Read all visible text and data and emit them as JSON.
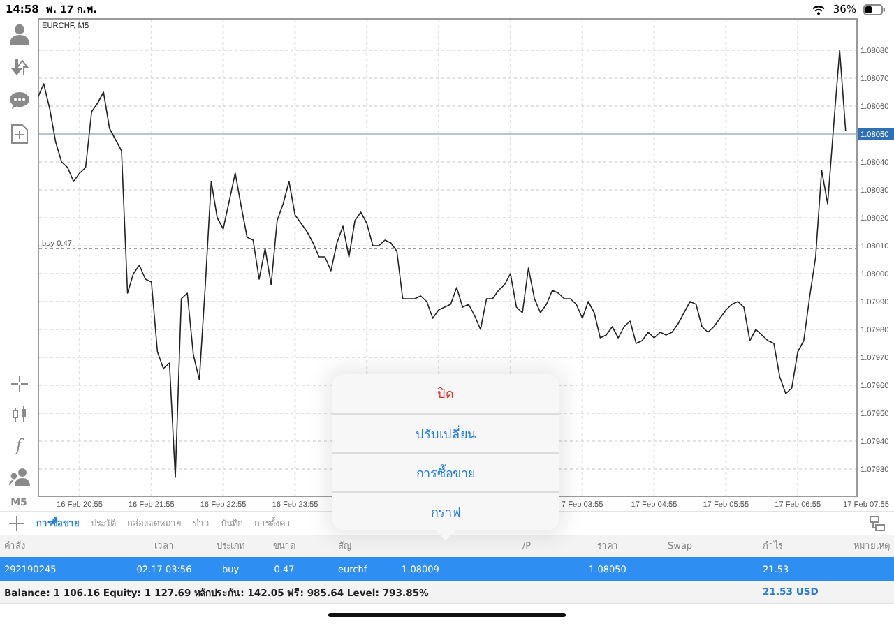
{
  "status_bar": {
    "time": "14:58",
    "date": "พ. 17 ก.พ.",
    "battery": "36%"
  },
  "toolbar": {
    "indicators_glyph": "f",
    "timeframe": "M5"
  },
  "chart": {
    "title": "EURCHF, M5",
    "chart_data": {
      "type": "line",
      "grid": true,
      "ylim": [
        1.0792,
        1.08091
      ],
      "categories": [
        null,
        null,
        null,
        null,
        null,
        null,
        null,
        "16 Feb 20:55",
        null,
        null,
        null,
        null,
        null,
        null,
        null,
        null,
        null,
        null,
        null,
        "16 Feb 21:55",
        null,
        null,
        null,
        null,
        null,
        null,
        null,
        null,
        null,
        null,
        null,
        "16 Feb 22:55",
        null,
        null,
        null,
        null,
        null,
        null,
        null,
        null,
        null,
        null,
        null,
        "16 Feb 23:55",
        null,
        null,
        null,
        null,
        null,
        null,
        null,
        null,
        null,
        null,
        null,
        null,
        null,
        null,
        null,
        null,
        null,
        null,
        null,
        null,
        null,
        null,
        null,
        null,
        null,
        null,
        null,
        null,
        null,
        null,
        null,
        null,
        null,
        null,
        null,
        null,
        null,
        null,
        null,
        null,
        null,
        null,
        null,
        null,
        null,
        null,
        null,
        "7 Feb 03:55",
        null,
        null,
        null,
        null,
        null,
        null,
        null,
        null,
        null,
        null,
        null,
        "17 Feb 04:55",
        null,
        null,
        null,
        null,
        null,
        null,
        null,
        null,
        null,
        null,
        null,
        "17 Feb 05:55",
        null,
        null,
        null,
        null,
        null,
        null,
        null,
        null,
        null,
        null,
        null,
        "17 Feb 06:55",
        null,
        null,
        null,
        null,
        null,
        null,
        null,
        null,
        null,
        null,
        null,
        "17 Feb 07:55"
      ],
      "yticks": [
        {
          "value": 1.0808,
          "label": "1.08080"
        },
        {
          "value": 1.0807,
          "label": "1.08070"
        },
        {
          "value": 1.0806,
          "label": "1.08060"
        },
        {
          "value": 1.0804,
          "label": "1.08040"
        },
        {
          "value": 1.0803,
          "label": "1.08030"
        },
        {
          "value": 1.0802,
          "label": "1.08020"
        },
        {
          "value": 1.0801,
          "label": "1.08010"
        },
        {
          "value": 1.08,
          "label": "1.08000"
        },
        {
          "value": 1.0799,
          "label": "1.07990"
        },
        {
          "value": 1.0798,
          "label": "1.07980"
        },
        {
          "value": 1.0797,
          "label": "1.07970"
        },
        {
          "value": 1.0796,
          "label": "1.07960"
        },
        {
          "value": 1.0795,
          "label": "1.07950"
        },
        {
          "value": 1.0794,
          "label": "1.07940"
        },
        {
          "value": 1.0793,
          "label": "1.07930"
        }
      ],
      "series": [
        {
          "color": "#222222",
          "values": [
            1.08063,
            1.08068,
            1.08059,
            1.08047,
            1.0804,
            1.08038,
            1.08033,
            1.08036,
            1.08038,
            1.08058,
            1.08061,
            1.08065,
            1.08052,
            1.08048,
            1.08044,
            1.07993,
            1.08,
            1.08003,
            1.07998,
            1.07997,
            1.07972,
            1.07966,
            1.07968,
            1.07927,
            1.07991,
            1.07993,
            1.07971,
            1.07962,
            1.07996,
            1.08033,
            1.0802,
            1.08016,
            1.08026,
            1.08036,
            1.08024,
            1.08013,
            1.08012,
            1.07998,
            1.08009,
            1.07996,
            1.08019,
            1.08025,
            1.08033,
            1.08021,
            1.08018,
            1.08015,
            1.08011,
            1.08006,
            1.08006,
            1.08001,
            1.08011,
            1.08017,
            1.08006,
            1.08019,
            1.08022,
            1.08018,
            1.0801,
            1.0801,
            1.08012,
            1.08011,
            1.08008,
            1.07991,
            1.07991,
            1.07991,
            1.07992,
            1.0799,
            1.07984,
            1.07987,
            1.07988,
            1.07989,
            1.07995,
            1.07988,
            1.07989,
            1.07985,
            1.0798,
            1.07991,
            1.07991,
            1.07994,
            1.07996,
            1.08,
            1.07988,
            1.07986,
            1.08002,
            1.07991,
            1.07986,
            1.07989,
            1.07994,
            1.07993,
            1.07991,
            1.07991,
            1.07989,
            1.07984,
            1.0799,
            1.07986,
            1.07977,
            1.07978,
            1.07981,
            1.07977,
            1.07981,
            1.07983,
            1.07975,
            1.07976,
            1.07979,
            1.07977,
            1.07979,
            1.07978,
            1.07979,
            1.07982,
            1.07986,
            1.0799,
            1.07989,
            1.07981,
            1.07979,
            1.07981,
            1.07984,
            1.07987,
            1.07989,
            1.0799,
            1.07988,
            1.07976,
            1.0798,
            1.07978,
            1.07976,
            1.07975,
            1.07963,
            1.07957,
            1.07959,
            1.07972,
            1.07976,
            1.07992,
            1.08006,
            1.08037,
            1.08025,
            1.08053,
            1.0808,
            1.08051,
            null,
            null,
            null,
            null
          ]
        }
      ],
      "ref_lines": [
        {
          "axis": "y",
          "value": 1.0805,
          "label": "1.08050",
          "color": "#b8c6d6"
        },
        {
          "axis": "y",
          "value": 1.08009,
          "label": "buy 0.47",
          "color": "#999999"
        }
      ]
    }
  },
  "popover": {
    "items": [
      {
        "label": "ปิด",
        "kind": "destructive"
      },
      {
        "label": "ปรับเปลี่ยน",
        "kind": "action"
      },
      {
        "label": "การซื้อขาย",
        "kind": "action"
      },
      {
        "label": "กราฟ",
        "kind": "action"
      }
    ]
  },
  "tabs": [
    {
      "label": "การซื้อขาย",
      "selected": true
    },
    {
      "label": "ประวัติ",
      "selected": false
    },
    {
      "label": "กล่องจดหมาย",
      "selected": false
    },
    {
      "label": "ข่าว",
      "selected": false
    },
    {
      "label": "บันทึก",
      "selected": false
    },
    {
      "label": "การตั้งค่า",
      "selected": false
    }
  ],
  "table": {
    "columns": [
      "คำสั่ง",
      "เวลา",
      "ประเภท",
      "ขนาด",
      "สัญ",
      "/P",
      "ราคา",
      "Swap",
      "กำไร",
      "หมายเหตุ"
    ],
    "rows": [
      {
        "order": "292190245",
        "time": "02.17 03:56",
        "type": "buy",
        "volume": "0.47",
        "symbol": "eurchf",
        "open_price": "1.08009",
        "price": "1.08050",
        "profit": "21.53",
        "selected": true
      }
    ]
  },
  "footer": {
    "summary": "Balance: 1 106.16 Equity: 1 127.69 หลักประกัน: 142.05 ฟรี: 985.64 Level: 793.85%",
    "profit": "21.53 USD"
  }
}
